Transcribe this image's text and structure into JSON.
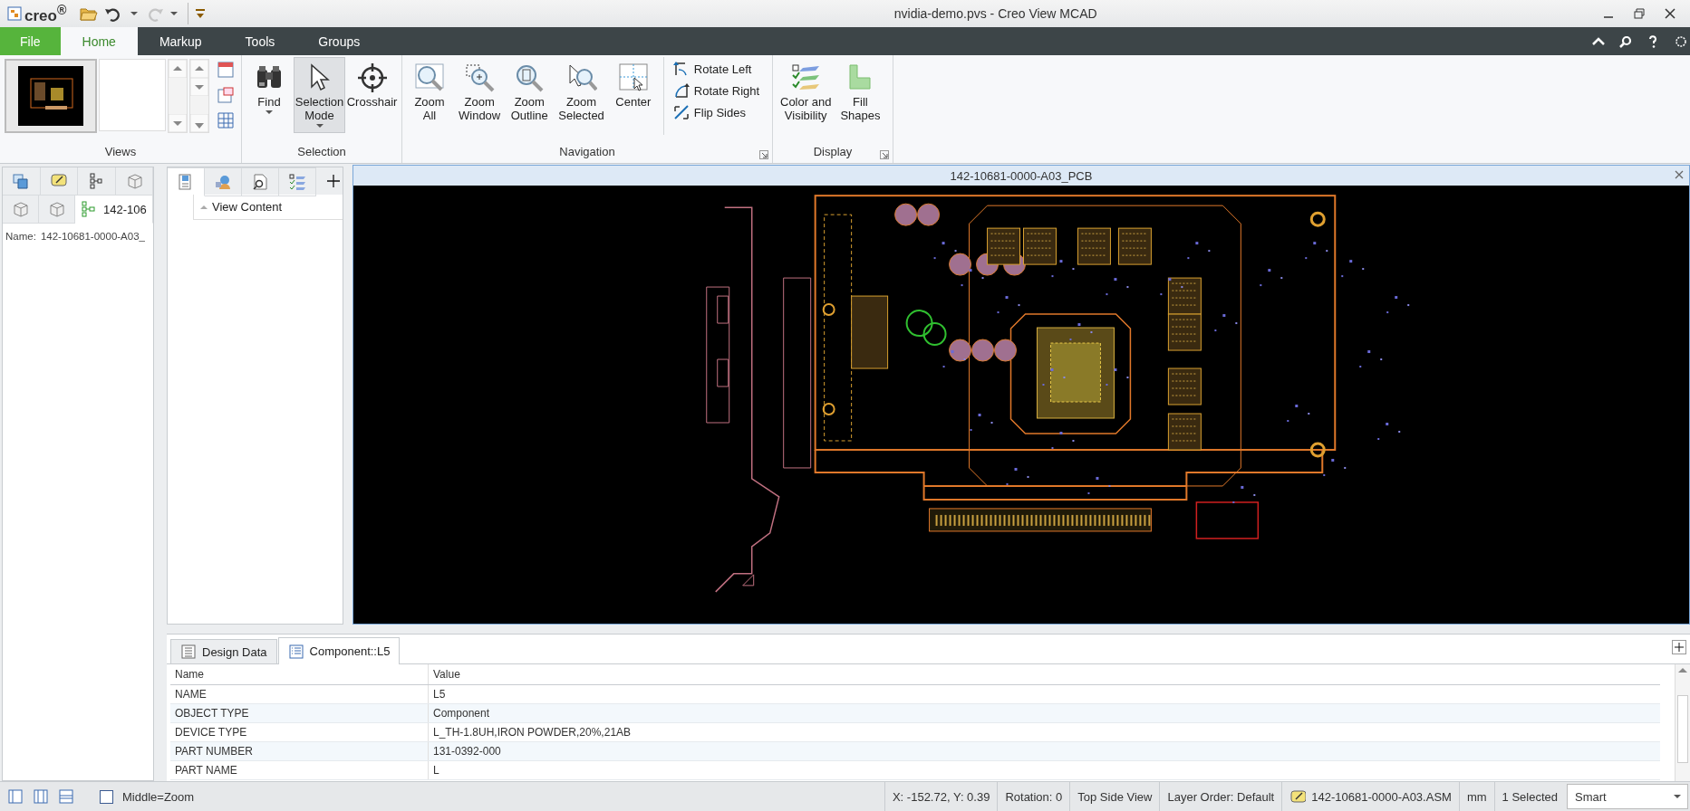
{
  "window": {
    "logo": "creo$^{®}$",
    "title": "nvidia-demo.pvs - Creo View MCAD"
  },
  "quick_access": [
    {
      "disabled": false
    },
    {
      "disabled": false
    },
    {
      "disabled": true
    }
  ],
  "menu_tabs": [
    {
      "label": "File",
      "kind": "file",
      "selected": false
    },
    {
      "label": "Home",
      "kind": "tab",
      "selected": true
    },
    {
      "label": "Markup",
      "kind": "tab",
      "selected": false
    },
    {
      "label": "Tools",
      "kind": "tab",
      "selected": false
    },
    {
      "label": "Groups",
      "kind": "tab",
      "selected": false
    }
  ],
  "ribbon": {
    "groups": [
      {
        "label": "Views",
        "kind": "gallery",
        "launcher": false
      },
      {
        "label": "Selection",
        "kind": "buttons",
        "launcher": false,
        "buttons": [
          {
            "lines": [
              "Find"
            ],
            "dropdown": true,
            "selected": false
          },
          {
            "lines": [
              "Selection",
              "Mode"
            ],
            "dropdown": true,
            "selected": true
          },
          {
            "lines": [
              "Crosshair"
            ],
            "dropdown": false,
            "selected": false
          }
        ]
      },
      {
        "label": "Navigation",
        "kind": "buttons",
        "launcher": true,
        "buttons": [
          {
            "lines": [
              "Zoom",
              "All"
            ],
            "dropdown": false,
            "selected": false
          },
          {
            "lines": [
              "Zoom",
              "Window"
            ],
            "dropdown": false,
            "selected": false
          },
          {
            "lines": [
              "Zoom",
              "Outline"
            ],
            "dropdown": false,
            "selected": false
          },
          {
            "lines": [
              "Zoom",
              "Selected"
            ],
            "dropdown": false,
            "selected": false
          },
          {
            "lines": [
              "Center"
            ],
            "dropdown": false,
            "selected": false
          }
        ],
        "small_buttons": [
          "Rotate Left",
          "Rotate Right",
          "Flip Sides"
        ]
      },
      {
        "label": "Display",
        "kind": "buttons",
        "launcher": true,
        "buttons": [
          {
            "lines": [
              "Color and",
              "Visibility"
            ],
            "dropdown": false,
            "selected": false
          },
          {
            "lines": [
              "Fill",
              "Shapes"
            ],
            "dropdown": false,
            "selected": false
          }
        ]
      }
    ]
  },
  "left_panel": {
    "tabs": [
      {
        "selected": false
      },
      {
        "selected": false
      },
      {
        "selected": false
      },
      {
        "selected": false
      },
      {
        "selected": false
      },
      {
        "selected": false
      },
      {
        "label": "142-106",
        "selected": true
      }
    ],
    "name_label": "Name:",
    "name_value": "142-10681-0000-A03_"
  },
  "middle_panel": {
    "tabs": [
      {
        "selected": true
      },
      {
        "selected": false
      },
      {
        "selected": false
      },
      {
        "selected": false
      }
    ],
    "column": "View Content"
  },
  "viewport": {
    "title": "142-10681-0000-A03_PCB"
  },
  "properties": {
    "tabs": [
      {
        "label": "Design Data",
        "selected": false
      },
      {
        "label": "Component::L5",
        "selected": true
      }
    ],
    "columns": [
      "Name",
      "Value"
    ],
    "rows": [
      [
        "NAME",
        "L5"
      ],
      [
        "OBJECT TYPE",
        "Component"
      ],
      [
        "DEVICE TYPE",
        "L_TH-1.8UH,IRON POWDER,20%,21AB"
      ],
      [
        "PART NUMBER",
        "131-0392-000"
      ],
      [
        "PART NAME",
        "L"
      ]
    ]
  },
  "status_bar": {
    "checked": false,
    "hint": "Middle=Zoom",
    "cells": [
      "X: -152.72, Y: 0.39",
      "Rotation: 0",
      "Top Side View",
      "Layer Order: Default"
    ],
    "model": "142-10681-0000-A03.ASM",
    "units": "mm",
    "selection": "1 Selected",
    "filter": "Smart"
  }
}
